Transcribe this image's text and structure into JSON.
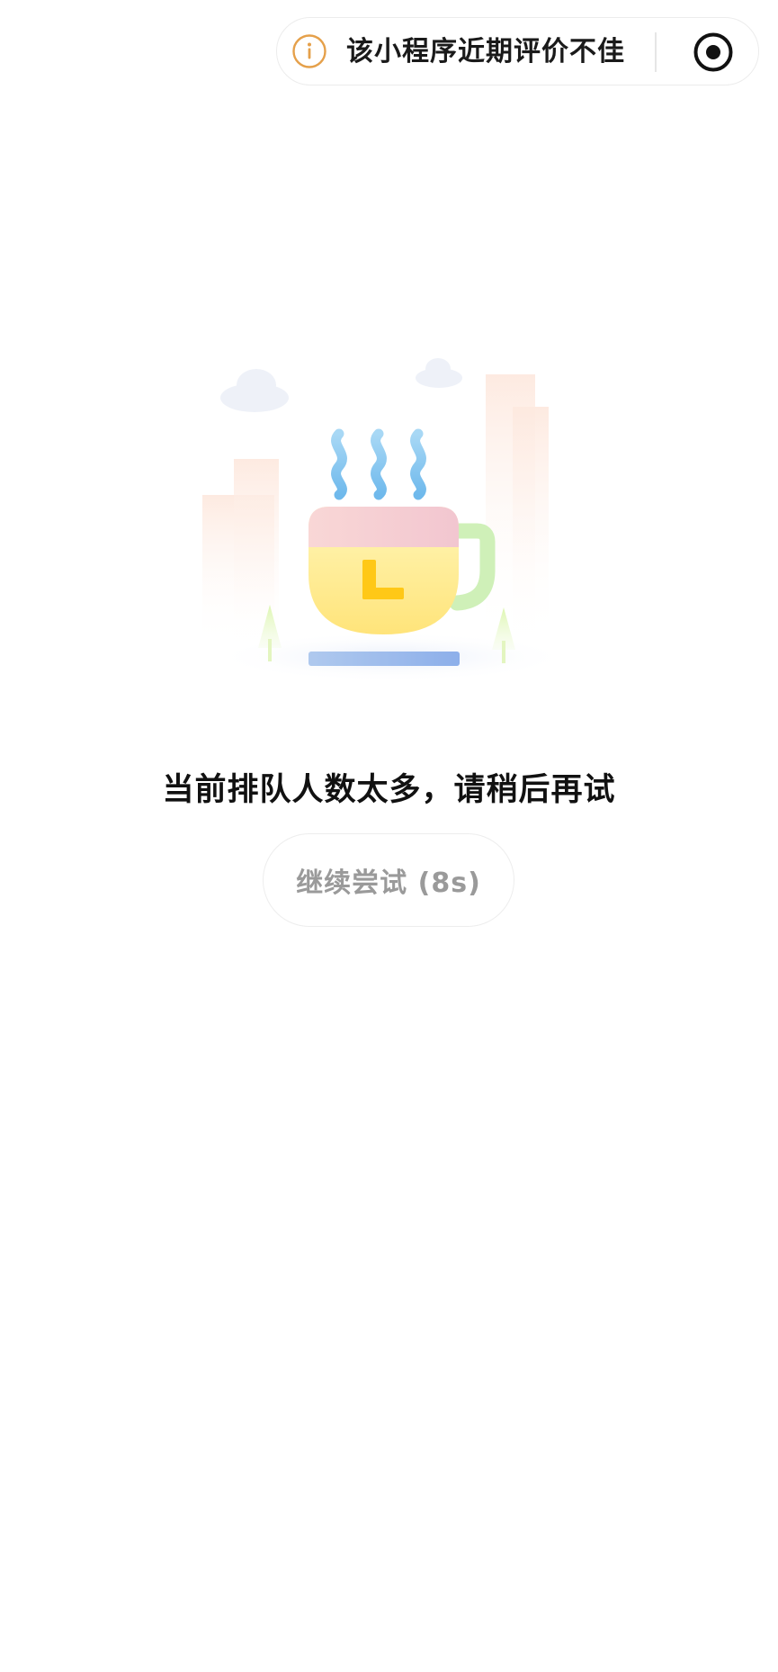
{
  "notice": {
    "icon": "info-circle-icon",
    "text": "该小程序近期评价不佳",
    "accent_color": "#E5A04A"
  },
  "capsule": {
    "record_icon": "record-circle-icon"
  },
  "illustration": {
    "icon": "coffee-cup-waiting-illustration"
  },
  "main": {
    "message": "当前排队人数太多，请稍后再试",
    "retry_label": "继续尝试 (8s)"
  }
}
